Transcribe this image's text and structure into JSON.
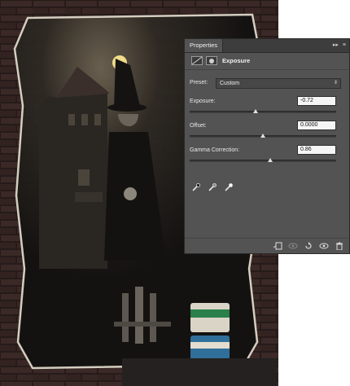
{
  "panel": {
    "tab_label": "Properties",
    "header_title": "Exposure",
    "preset": {
      "label": "Preset:",
      "value": "Custom"
    },
    "exposure": {
      "label": "Exposure:",
      "value": "-0.72",
      "slider_fraction": 0.45
    },
    "offset": {
      "label": "Offset:",
      "value": "0.0000",
      "slider_fraction": 0.5
    },
    "gamma": {
      "label": "Gamma Correction:",
      "value": "0.86",
      "slider_fraction": 0.55
    },
    "eyedroppers": [
      "black-point-eyedropper-icon",
      "gray-point-eyedropper-icon",
      "white-point-eyedropper-icon"
    ],
    "bottom_icons": [
      "clip-to-layer-icon",
      "visibility-link-icon",
      "reset-icon",
      "eye-icon",
      "trash-icon"
    ]
  },
  "colors": {
    "panel_bg": "#535353",
    "tabbar_bg": "#3d3d3d",
    "input_bg": "#f5f5f5",
    "canvas_bg": "#2a2624"
  }
}
